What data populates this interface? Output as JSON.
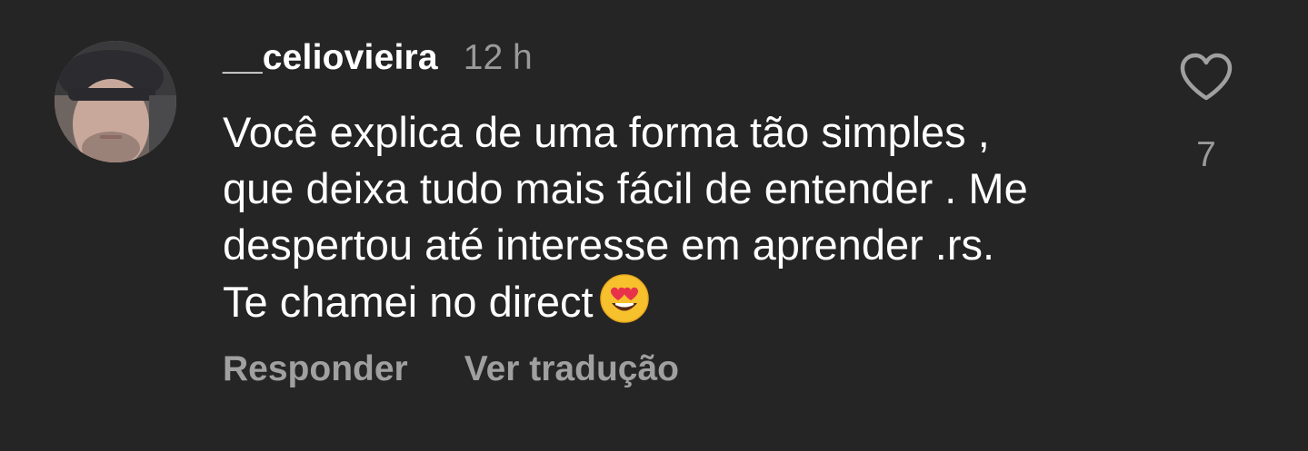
{
  "comment": {
    "username": "__celiovieira",
    "timestamp": "12 h",
    "text_lines": [
      "Você explica de uma forma tão simples ,",
      "que deixa tudo mais fácil de entender . Me",
      "despertou até interesse em aprender .rs.",
      "Te chamei no direct"
    ],
    "emoji": "smiling-face-with-heart-eyes-icon",
    "likes": "7"
  },
  "actions": {
    "reply_label": "Responder",
    "translate_label": "Ver tradução"
  },
  "colors": {
    "background": "#252525",
    "primary_text": "#ffffff",
    "secondary_text": "#9a9a9a"
  }
}
